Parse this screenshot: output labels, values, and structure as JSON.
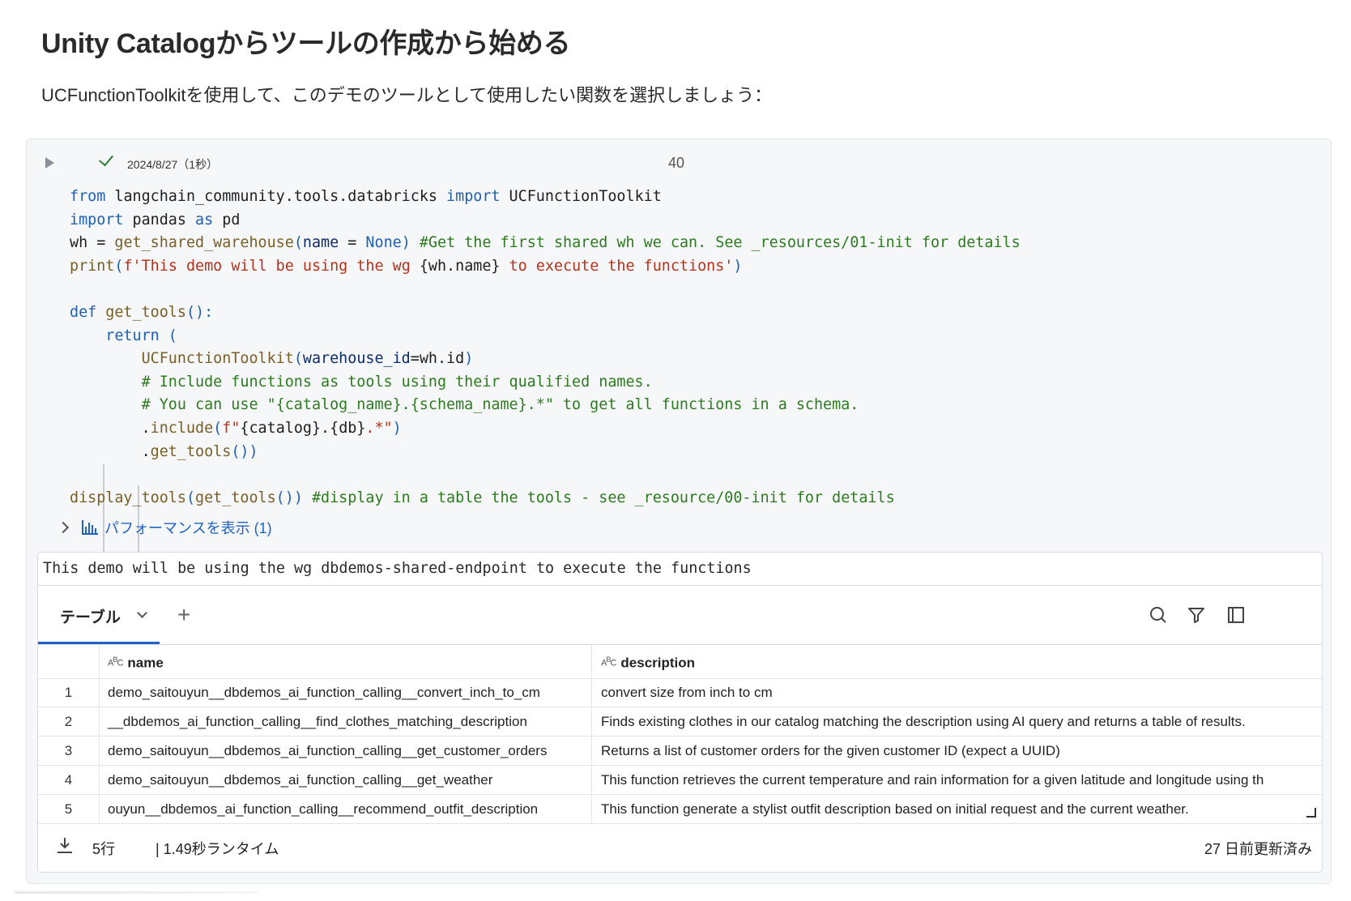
{
  "header": {
    "title": "Unity Catalogからツールの作成から始める",
    "subtitle": "UCFunctionToolkitを使用して、このデモのツールとして使用したい関数を選択しましょう："
  },
  "cell": {
    "run_date": "2024/8/27",
    "run_duration": "（1秒）",
    "cell_number": "40",
    "perf_label": "パフォーマンスを表示 (1)",
    "stdout": "This demo will be using the wg dbdemos-shared-endpoint to execute the functions"
  },
  "result": {
    "tab_label": "テーブル",
    "add_label": "+",
    "columns": [
      "name",
      "description"
    ],
    "rows": [
      {
        "idx": "1",
        "name": "demo_saitouyun__dbdemos_ai_function_calling__convert_inch_to_cm",
        "description": "convert size from inch to cm"
      },
      {
        "idx": "2",
        "name": "__dbdemos_ai_function_calling__find_clothes_matching_description",
        "description": "Finds existing clothes in our catalog matching the description using AI query and returns a table of results."
      },
      {
        "idx": "3",
        "name": "demo_saitouyun__dbdemos_ai_function_calling__get_customer_orders",
        "description": "Returns a list of customer orders for the given customer ID (expect a UUID)"
      },
      {
        "idx": "4",
        "name": "demo_saitouyun__dbdemos_ai_function_calling__get_weather",
        "description": "This function retrieves the current temperature and rain information for a given latitude and longitude using th"
      },
      {
        "idx": "5",
        "name": "ouyun__dbdemos_ai_function_calling__recommend_outfit_description",
        "description": "This function generate a stylist outfit description based on initial request and the current weather."
      }
    ],
    "footer": {
      "rows_count": "5行",
      "runtime": "| 1.49秒ランタイム",
      "updated": "27 日前更新済み"
    }
  },
  "code": {
    "l1_from": "from",
    "l1_mod": " langchain_community.tools.databricks ",
    "l1_import": "import",
    "l1_cls": " UCFunctionToolkit",
    "l2_import": "import",
    "l2_mod": " pandas ",
    "l2_as": "as",
    "l2_alias": " pd",
    "l3_a": "wh = ",
    "l3_fn": "get_shared_warehouse",
    "l3_p1": "(",
    "l3_prm": "name",
    "l3_eq": " = ",
    "l3_none": "None",
    "l3_p2": ")",
    "l3_cm": " #Get the first shared wh we can. See _resources/01-init for details",
    "l4_fn": "print",
    "l4_p1": "(",
    "l4_s1": "f'This demo will be using the wg ",
    "l4_expr": "{wh.name}",
    "l4_s2": " to execute the functions'",
    "l4_p2": ")",
    "l6_def": "def",
    "l6_fn": " get_tools",
    "l6_rest": "():",
    "l7_return": "    return",
    "l7_p": " (",
    "l8_cls": "        UCFunctionToolkit",
    "l8_p1": "(",
    "l8_prm": "warehouse_id",
    "l8_rest": "=wh.id",
    "l8_p2": ")",
    "l9_cm": "        # Include functions as tools using their qualified names.",
    "l10_cm": "        # You can use \"{catalog_name}.{schema_name}.*\" to get all functions in a schema.",
    "l11_a": "        .",
    "l11_fn": "include",
    "l11_p1": "(",
    "l11_s1": "f\"",
    "l11_expr": "{catalog}.{db}",
    "l11_s2": ".*\"",
    "l11_p2": ")",
    "l12_a": "        .",
    "l12_fn": "get_tools",
    "l12_p": "())",
    "l14_fn": "display_tools",
    "l14_p1": "(",
    "l14_fn2": "get_tools",
    "l14_p2": "())",
    "l14_cm": " #display in a table the tools - see _resource/00-init for details"
  }
}
